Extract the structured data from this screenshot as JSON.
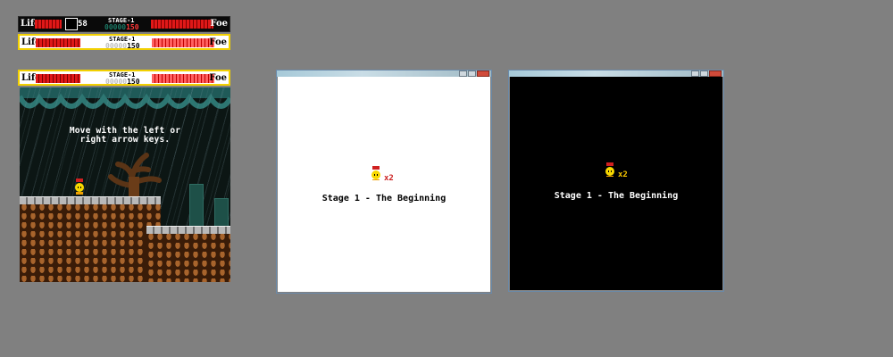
{
  "hud": {
    "life_label": "Life",
    "foe_label": "Foe",
    "stage_label": "STAGE-1",
    "score_zeros": "00000",
    "score_value": "150",
    "timer": "58"
  },
  "game": {
    "tutorial_line1": "Move with the left or",
    "tutorial_line2": "right arrow keys."
  },
  "window_white": {
    "lives": "x2",
    "caption": "Stage 1 - The Beginning",
    "background": "#ffffff",
    "caption_color": "#000000",
    "lives_color": "#cc2222"
  },
  "window_black": {
    "lives": "x2",
    "caption": "Stage 1 - The Beginning",
    "background": "#000000",
    "caption_color": "#ffffff",
    "lives_color": "#f5c400"
  },
  "colors": {
    "desktop": "#808080",
    "health": "#e01818",
    "hud_border": "#f2d000"
  }
}
